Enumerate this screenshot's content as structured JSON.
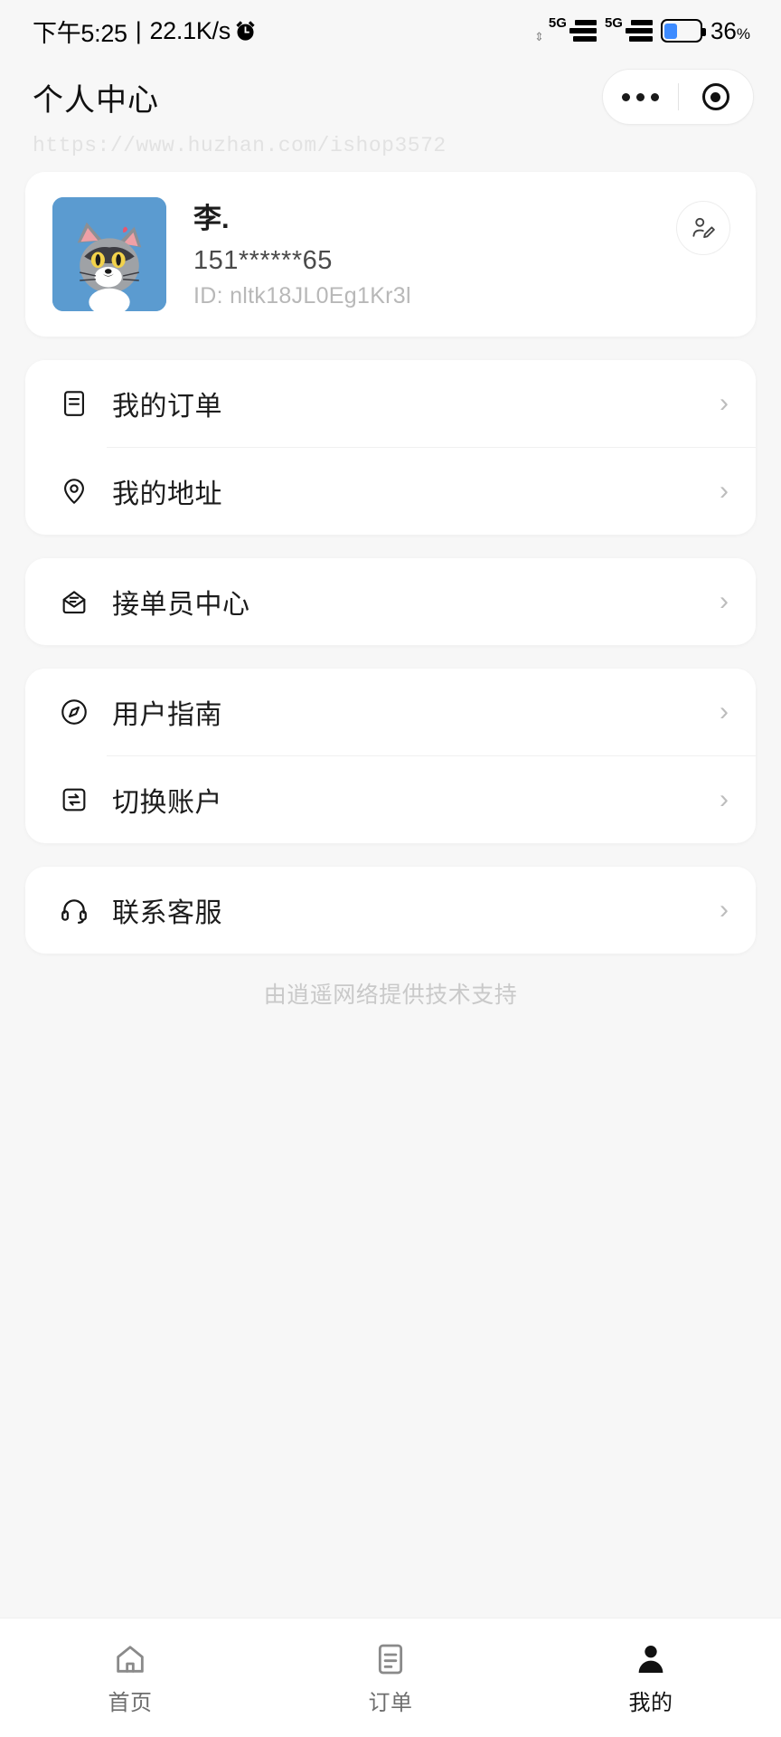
{
  "status_bar": {
    "time": "下午5:25",
    "separator": "|",
    "network_speed": "22.1K/s",
    "alarm_icon": "alarm-icon",
    "sim1_label": "5G",
    "sim2_label": "5G",
    "battery_percent": "36",
    "battery_percent_symbol": "%",
    "battery_level": 36,
    "battery_color": "#3d8bff"
  },
  "header": {
    "title": "个人中心",
    "menu_icon": "more-dots-icon",
    "capsule_icon": "target-circle-icon"
  },
  "watermark": {
    "url": "https://www.huzhan.com/ishop3572"
  },
  "profile": {
    "avatar_icon": "cat-avatar-image",
    "avatar_bg": "#5b9bd0",
    "name": "李.",
    "phone": "151******65",
    "id": "ID: nltk18JL0Eg1Kr3l",
    "edit_icon": "edit-profile-icon"
  },
  "menu_groups": [
    {
      "items": [
        {
          "label": "我的订单",
          "icon": "order-list-icon",
          "chevron": "›"
        },
        {
          "label": "我的地址",
          "icon": "location-pin-icon",
          "chevron": "›"
        }
      ]
    },
    {
      "items": [
        {
          "label": "接单员中心",
          "icon": "inbox-envelope-icon",
          "chevron": "›"
        }
      ]
    },
    {
      "items": [
        {
          "label": "用户指南",
          "icon": "compass-guide-icon",
          "chevron": "›"
        },
        {
          "label": "切换账户",
          "icon": "switch-account-icon",
          "chevron": "›"
        }
      ]
    },
    {
      "items": [
        {
          "label": "联系客服",
          "icon": "headset-support-icon",
          "chevron": "›"
        }
      ]
    }
  ],
  "footer": {
    "note": "由逍遥网络提供技术支持"
  },
  "tabbar": {
    "items": [
      {
        "label": "首页",
        "icon": "home-icon",
        "active": false
      },
      {
        "label": "订单",
        "icon": "orders-icon",
        "active": false
      },
      {
        "label": "我的",
        "icon": "profile-person-icon",
        "active": true
      }
    ]
  }
}
